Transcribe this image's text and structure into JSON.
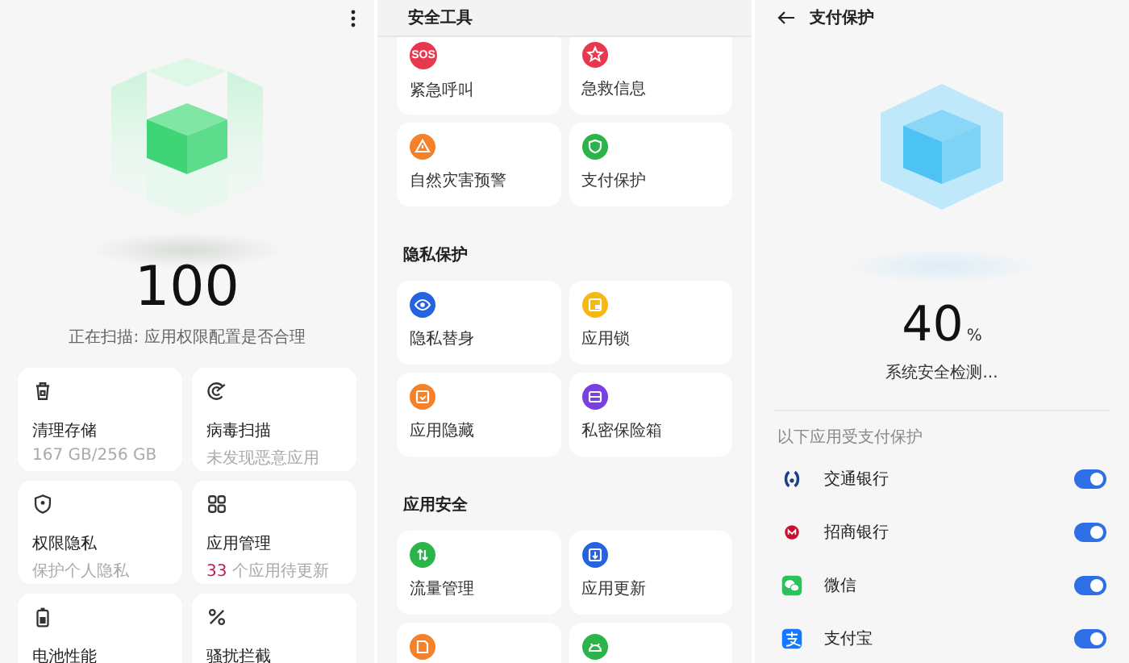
{
  "home": {
    "score": "100",
    "status": "正在扫描: 应用权限配置是否合理",
    "cards": [
      {
        "kind": "storage",
        "title": "清理存储",
        "subtitle": "167 GB/256 GB"
      },
      {
        "kind": "virus",
        "title": "病毒扫描",
        "subtitle": "未发现恶意应用"
      },
      {
        "kind": "privacy",
        "title": "权限隐私",
        "subtitle": "保护个人隐私"
      },
      {
        "kind": "apps",
        "title": "应用管理",
        "count": "33",
        "subtitle": "个应用待更新"
      },
      {
        "kind": "battery",
        "title": "电池性能"
      },
      {
        "kind": "block",
        "title": "骚扰拦截"
      }
    ]
  },
  "tools": {
    "title": "安全工具",
    "sections": [
      {
        "items": [
          {
            "kind": "sos",
            "glyph": "SOS",
            "color": "#e8384f",
            "label": "紧急呼叫"
          },
          {
            "kind": "medical",
            "color": "#e8384f",
            "label": "急救信息"
          },
          {
            "kind": "warning",
            "color": "#f5812a",
            "label": "自然灾害预警"
          },
          {
            "kind": "shield",
            "color": "#2bb44a",
            "label": "支付保护"
          }
        ]
      },
      {
        "heading": "隐私保护",
        "items": [
          {
            "kind": "eye",
            "color": "#2563e0",
            "label": "隐私替身"
          },
          {
            "kind": "lock",
            "color": "#f5b915",
            "label": "应用锁"
          },
          {
            "kind": "hide",
            "color": "#f5812a",
            "label": "应用隐藏"
          },
          {
            "kind": "vault",
            "color": "#7a3fe0",
            "label": "私密保险箱"
          }
        ]
      },
      {
        "heading": "应用安全",
        "items": [
          {
            "kind": "traffic",
            "color": "#2bb44a",
            "label": "流量管理"
          },
          {
            "kind": "update",
            "color": "#2563e0",
            "label": "应用更新"
          },
          {
            "kind": "doc",
            "color": "#f5812a"
          },
          {
            "kind": "android",
            "color": "#2bb44a"
          }
        ]
      }
    ]
  },
  "payment": {
    "title": "支付保护",
    "percent": "40",
    "unit": "%",
    "status": "系统安全检测...",
    "list_heading": "以下应用受支付保护",
    "apps": [
      {
        "kind": "bocom",
        "name": "交通银行",
        "on": true
      },
      {
        "kind": "cmb",
        "name": "招商银行",
        "on": true
      },
      {
        "kind": "wechat",
        "name": "微信",
        "on": true
      },
      {
        "kind": "alipay",
        "name": "支付宝",
        "on": true
      }
    ]
  }
}
